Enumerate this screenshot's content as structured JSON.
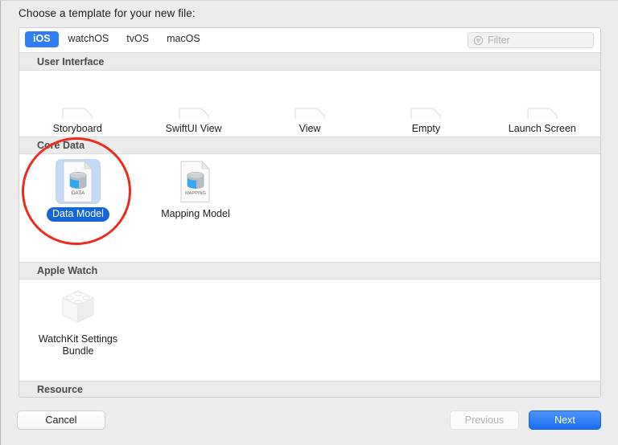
{
  "dialog": {
    "prompt": "Choose a template for your new file:"
  },
  "toolbar": {
    "tabs": [
      {
        "label": "iOS",
        "active": true
      },
      {
        "label": "watchOS",
        "active": false
      },
      {
        "label": "tvOS",
        "active": false
      },
      {
        "label": "macOS",
        "active": false
      }
    ],
    "filter": {
      "placeholder": "Filter",
      "value": "",
      "icon": "filter-icon"
    }
  },
  "sections": [
    {
      "title": "User Interface",
      "items": [
        {
          "label": "Storyboard",
          "icon": "storyboard-document-icon",
          "selected": false
        },
        {
          "label": "SwiftUI View",
          "icon": "swiftui-view-document-icon",
          "selected": false
        },
        {
          "label": "View",
          "icon": "view-document-icon",
          "selected": false
        },
        {
          "label": "Empty",
          "icon": "empty-document-icon",
          "selected": false
        },
        {
          "label": "Launch Screen",
          "icon": "launch-screen-document-icon",
          "selected": false
        }
      ]
    },
    {
      "title": "Core Data",
      "items": [
        {
          "label": "Data Model",
          "icon": "data-model-document-icon",
          "badge": "DATA",
          "selected": true
        },
        {
          "label": "Mapping Model",
          "icon": "mapping-model-document-icon",
          "badge": "MAPPING",
          "selected": false
        }
      ]
    },
    {
      "title": "Apple Watch",
      "items": [
        {
          "label": "WatchKit Settings Bundle",
          "icon": "watchkit-settings-bundle-icon",
          "selected": false
        }
      ]
    },
    {
      "title": "Resource",
      "items": []
    }
  ],
  "annotation": {
    "shape": "ellipse",
    "color": "#ee2b1c",
    "target": "Data Model"
  },
  "footer": {
    "cancel": "Cancel",
    "previous": "Previous",
    "next": "Next"
  },
  "colors": {
    "accent": "#2f7cf6",
    "selected_label_bg": "#1565d8",
    "selected_icon_bg": "#c2d9f7",
    "annotation": "#ee2b1c",
    "window_bg": "#ececec",
    "section_header_bg": "#ebebeb"
  }
}
